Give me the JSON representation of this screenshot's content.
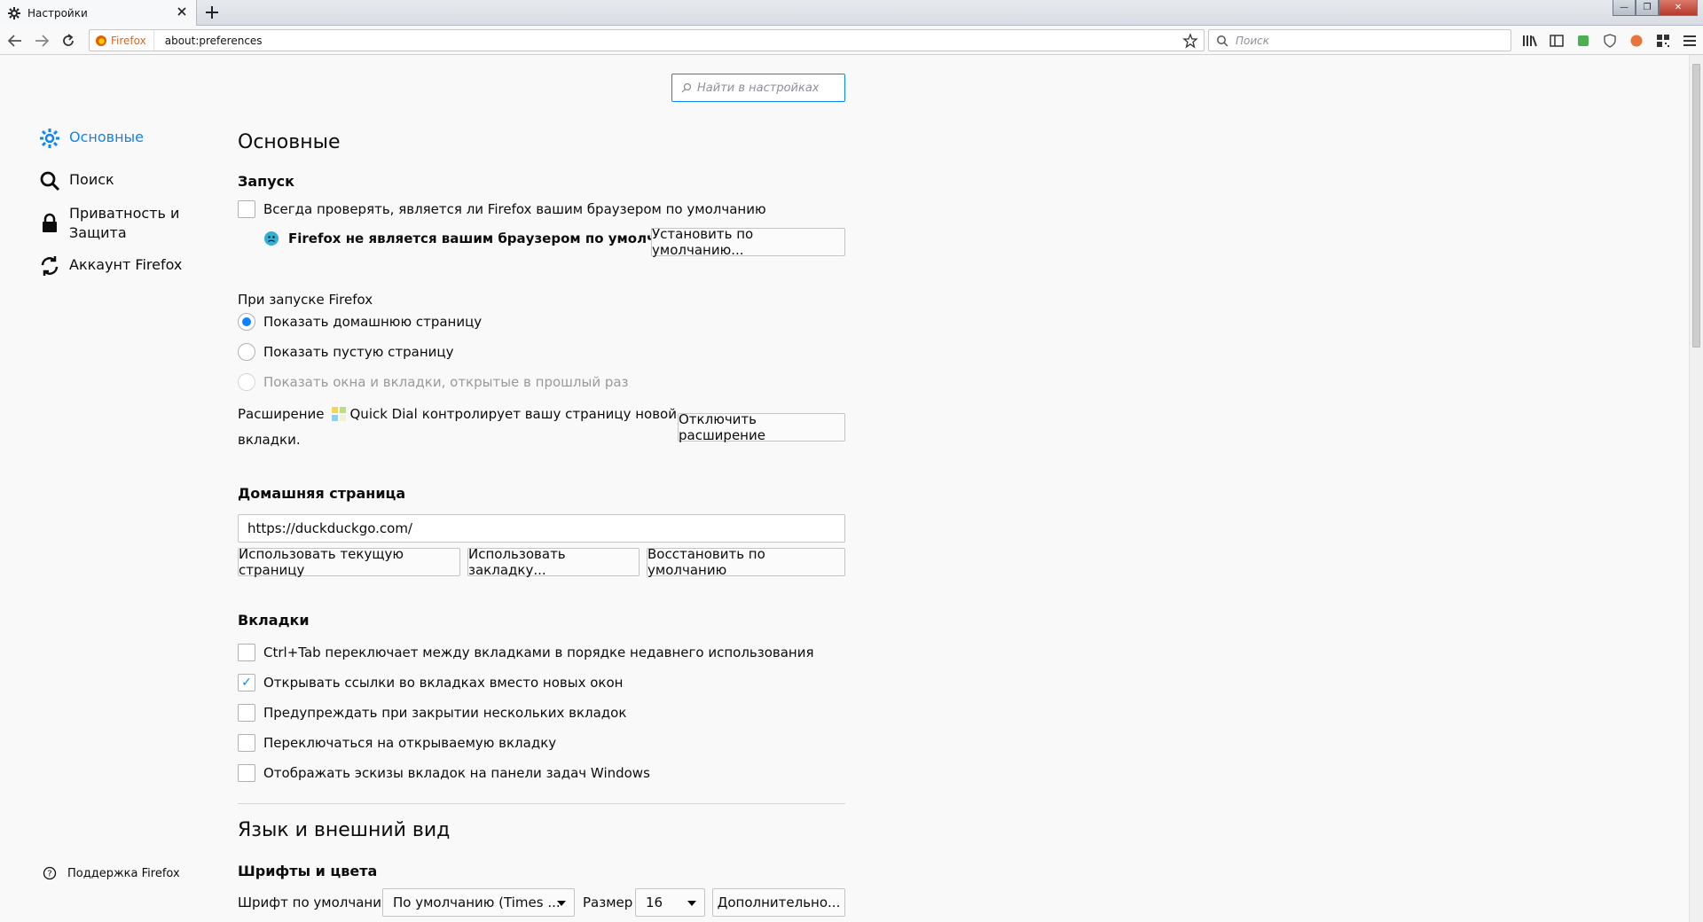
{
  "window": {
    "tab_title": "Настройки",
    "new_tab_label": "+"
  },
  "navbar": {
    "identity_label": "Firefox",
    "url": "about:preferences",
    "search_placeholder": "Поиск"
  },
  "prefs_search": {
    "placeholder": "Найти в настройках"
  },
  "sidebar": {
    "items": [
      {
        "label": "Основные",
        "icon": "gear-icon",
        "selected": true
      },
      {
        "label": "Поиск",
        "icon": "search-icon",
        "selected": false
      },
      {
        "label": "Приватность и Защита",
        "icon": "lock-icon",
        "selected": false
      },
      {
        "label": "Аккаунт Firefox",
        "icon": "sync-icon",
        "selected": false
      }
    ],
    "support_label": "Поддержка Firefox"
  },
  "general": {
    "title": "Основные",
    "startup": {
      "heading": "Запуск",
      "always_check_label": "Всегда проверять, является ли Firefox вашим браузером по умолчанию",
      "not_default_text": "Firefox не является вашим браузером по умолчанию",
      "set_default_button": "Установить по умолчанию...",
      "on_startup_label": "При запуске Firefox",
      "options": [
        {
          "label": "Показать домашнюю страницу",
          "selected": true,
          "disabled": false
        },
        {
          "label": "Показать пустую страницу",
          "selected": false,
          "disabled": false
        },
        {
          "label": "Показать окна и вкладки, открытые в прошлый раз",
          "selected": false,
          "disabled": true
        }
      ],
      "extension_text_1": "Расширение",
      "extension_name": "Quick Dial",
      "extension_text_2": "контролирует вашу страницу новой",
      "extension_text_3": "вкладки.",
      "disable_extension_button": "Отключить расширение"
    },
    "home": {
      "heading": "Домашняя страница",
      "url_value": "https://duckduckgo.com/",
      "use_current_button": "Использовать текущую страницу",
      "use_bookmark_button": "Использовать закладку...",
      "restore_default_button": "Восстановить по умолчанию"
    },
    "tabs": {
      "heading": "Вкладки",
      "options": [
        {
          "label": "Ctrl+Tab переключает между вкладками в порядке недавнего использования",
          "checked": false
        },
        {
          "label": "Открывать ссылки во вкладках вместо новых окон",
          "checked": true
        },
        {
          "label": "Предупреждать при закрытии нескольких вкладок",
          "checked": false
        },
        {
          "label": "Переключаться на открываемую вкладку",
          "checked": false
        },
        {
          "label": "Отображать эскизы вкладок на панели задач Windows",
          "checked": false
        }
      ]
    },
    "language": {
      "title": "Язык и внешний вид",
      "fonts_heading": "Шрифты и цвета",
      "default_font_label": "Шрифт по умолчанию",
      "default_font_value": "По умолчанию (Times ...",
      "size_label": "Размер",
      "size_value": "16",
      "advanced_button": "Дополнительно..."
    }
  },
  "colors": {
    "accent": "#0a84ff",
    "background": "#f9f9fa"
  }
}
